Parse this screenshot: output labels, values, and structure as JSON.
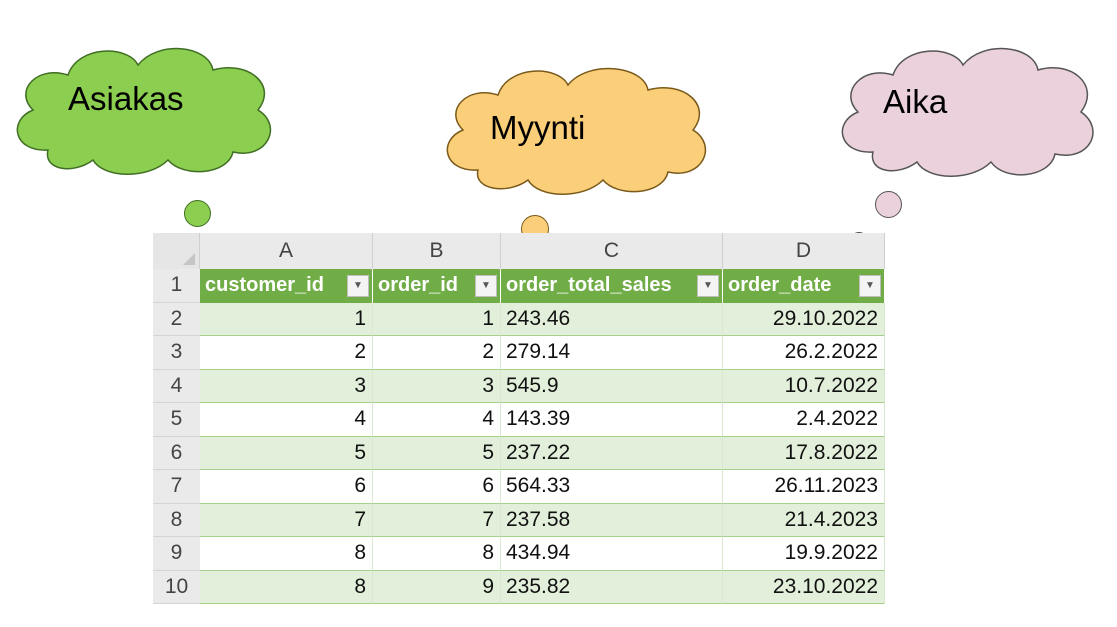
{
  "clouds": {
    "customer": {
      "label": "Asiakas",
      "color": "#8cce4f"
    },
    "sales": {
      "label": "Myynti",
      "color": "#fbcf79"
    },
    "time": {
      "label": "Aika",
      "color": "#ead1dc"
    }
  },
  "sheet": {
    "column_letters": [
      "A",
      "B",
      "C",
      "D"
    ],
    "header": {
      "row_number": "1",
      "columns": [
        "customer_id",
        "order_id",
        "order_total_sales",
        "order_date"
      ],
      "filter_icon": "dropdown-arrow-icon"
    },
    "rows": [
      {
        "n": "2",
        "customer_id": "1",
        "order_id": "1",
        "order_total_sales": "243.46",
        "order_date": "29.10.2022"
      },
      {
        "n": "3",
        "customer_id": "2",
        "order_id": "2",
        "order_total_sales": "279.14",
        "order_date": "26.2.2022"
      },
      {
        "n": "4",
        "customer_id": "3",
        "order_id": "3",
        "order_total_sales": "545.9",
        "order_date": "10.7.2022"
      },
      {
        "n": "5",
        "customer_id": "4",
        "order_id": "4",
        "order_total_sales": "143.39",
        "order_date": "2.4.2022"
      },
      {
        "n": "6",
        "customer_id": "5",
        "order_id": "5",
        "order_total_sales": "237.22",
        "order_date": "17.8.2022"
      },
      {
        "n": "7",
        "customer_id": "6",
        "order_id": "6",
        "order_total_sales": "564.33",
        "order_date": "26.11.2023"
      },
      {
        "n": "8",
        "customer_id": "7",
        "order_id": "7",
        "order_total_sales": "237.58",
        "order_date": "21.4.2023"
      },
      {
        "n": "9",
        "customer_id": "8",
        "order_id": "8",
        "order_total_sales": "434.94",
        "order_date": "19.9.2022"
      },
      {
        "n": "10",
        "customer_id": "8",
        "order_id": "9",
        "order_total_sales": "235.82",
        "order_date": "23.10.2022"
      }
    ],
    "colors": {
      "header_green": "#70ad47",
      "band_green": "#e2efda",
      "border_green": "#a8d08d"
    }
  }
}
